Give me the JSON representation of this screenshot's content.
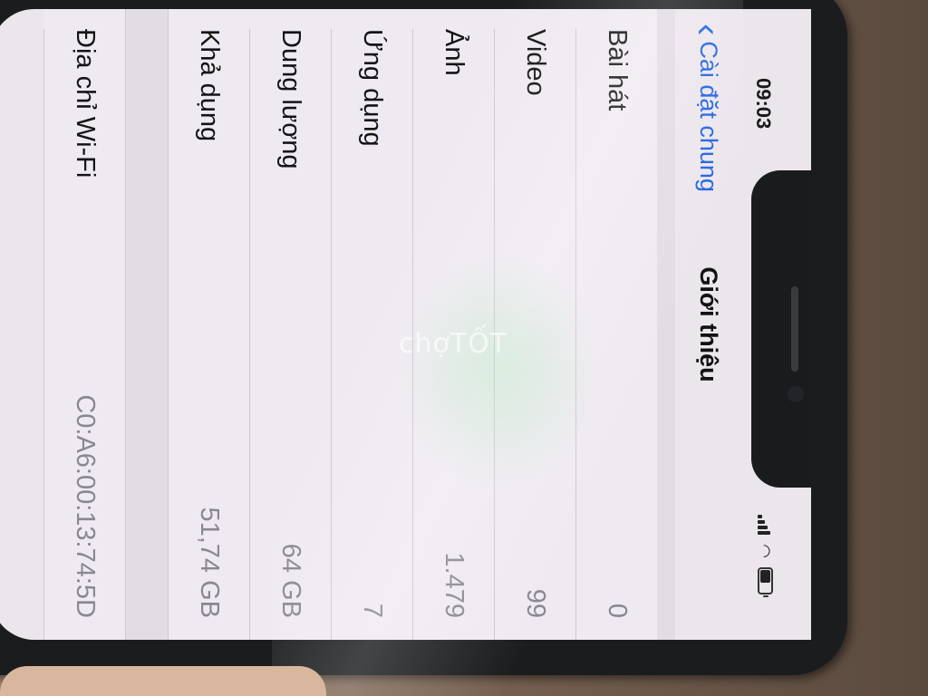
{
  "status_bar": {
    "time": "09:03",
    "signal_bars": 4,
    "wifi_icon": "wifi-icon",
    "battery_icon": "battery-icon"
  },
  "nav": {
    "back_label": "Cài đặt chung",
    "title": "Giới thiệu"
  },
  "rows": [
    {
      "label": "Bài hát",
      "value": "0"
    },
    {
      "label": "Video",
      "value": "99"
    },
    {
      "label": "Ảnh",
      "value": "1.479"
    },
    {
      "label": "Ứng dụng",
      "value": "7"
    },
    {
      "label": "Dung lượng",
      "value": "64 GB"
    },
    {
      "label": "Khả dụng",
      "value": "51,74 GB"
    }
  ],
  "partial_row": {
    "label": "Địa chỉ Wi-Fi",
    "value": "C0:A6:00:13:74:5D"
  },
  "watermark": "chợTỐT",
  "colors": {
    "accent": "#1f63e0",
    "background": "#efeaf1"
  }
}
